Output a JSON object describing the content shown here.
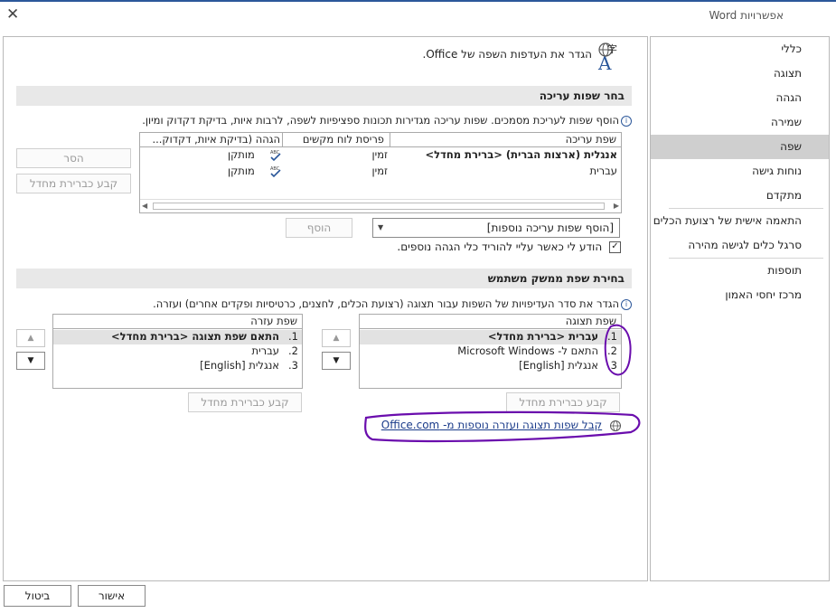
{
  "window": {
    "title": "אפשרויות Word",
    "close_glyph": "✕"
  },
  "sidebar": {
    "items": [
      {
        "label": "כללי"
      },
      {
        "label": "תצוגה"
      },
      {
        "label": "הגהה"
      },
      {
        "label": "שמירה"
      },
      {
        "label": "שפה",
        "selected": true
      },
      {
        "label": "נוחות גישה"
      },
      {
        "label": "מתקדם"
      },
      {
        "label": "התאמה אישית של רצועת הכלים"
      },
      {
        "label": "סרגל כלים לגישה מהירה"
      },
      {
        "label": "תוספות"
      },
      {
        "label": "מרכז יחסי האמון"
      }
    ]
  },
  "header": {
    "title": "הגדר את העדפות השפה של Office.",
    "icon": "language-icon"
  },
  "editing": {
    "section_title": "בחר שפות עריכה",
    "description": "הוסף שפות לעריכת מסמכים. שפות עריכה מגדירות תכונות ספציפיות לשפה, לרבות איות, בדיקת דקדוק ומיון.",
    "columns": [
      "שפת עריכה",
      "פריסת לוח מקשים",
      "הגהה (בדיקת איות, דקדוק..."
    ],
    "rows": [
      {
        "language": "אנגלית (ארצות הברית) <ברירת מחדל>",
        "keyboard": "זמין",
        "proofing": "מותקן"
      },
      {
        "language": "עברית",
        "keyboard": "זמין",
        "proofing": "מותקן"
      }
    ],
    "remove_button": "הסר",
    "set_default_button": "קבע כברירת מחדל",
    "add_dropdown": "[הוסף שפות עריכה נוספות]",
    "add_button": "הוסף",
    "notify_checkbox": "הודע לי כאשר עליי להוריד כלי הגהה נוספים.",
    "notify_checked": true
  },
  "ui_language": {
    "section_title": "בחירת שפת ממשק משתמש",
    "description": "הגדר את סדר העדיפויות של השפות עבור תצוגה (רצועת הכלים, לחצנים, כרטיסיות ופקדים אחרים) ועזרה.",
    "display_header": "שפת תצוגה",
    "display_items": [
      {
        "num": "1.",
        "label": "עברית <ברירת מחדל>"
      },
      {
        "num": "2.",
        "label": "התאם ל- Microsoft Windows"
      },
      {
        "num": "3.",
        "label": "אנגלית [English]"
      }
    ],
    "help_header": "שפת עזרה",
    "help_items": [
      {
        "num": "1.",
        "label": "התאם שפת תצוגה <ברירת מחדל>"
      },
      {
        "num": "2.",
        "label": "עברית"
      },
      {
        "num": "3.",
        "label": "אנגלית [English]"
      }
    ],
    "set_default_display": "קבע כברירת מחדל",
    "set_default_help": "קבע כברירת מחדל",
    "office_link": "קבל שפות תצוגה ועזרה נוספות מ- Office.com"
  },
  "footer": {
    "ok": "אישור",
    "cancel": "ביטול"
  },
  "colors": {
    "accent": "#2b579a",
    "annotation": "#6a0dad",
    "selected": "#cfcfcf"
  }
}
